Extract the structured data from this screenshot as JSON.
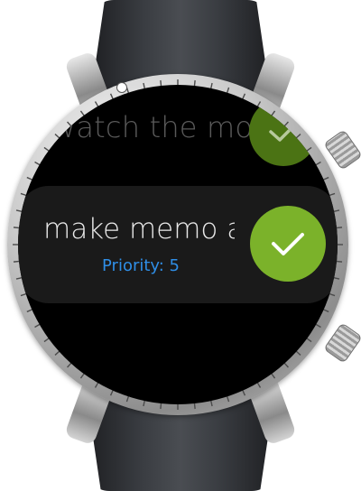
{
  "device": {
    "type": "smartwatch"
  },
  "todo_list": {
    "items": [
      {
        "title": "watch the mov",
        "completed_icon": "check-icon",
        "state": "faded"
      },
      {
        "title": "make memo a",
        "priority": "Priority: 5",
        "completed_icon": "check-icon",
        "state": "focused"
      }
    ]
  },
  "colors": {
    "check_active": "#7bb22a",
    "check_faded": "#4b7314",
    "priority_text": "#2f8ee6",
    "screen_bg": "#000000"
  }
}
